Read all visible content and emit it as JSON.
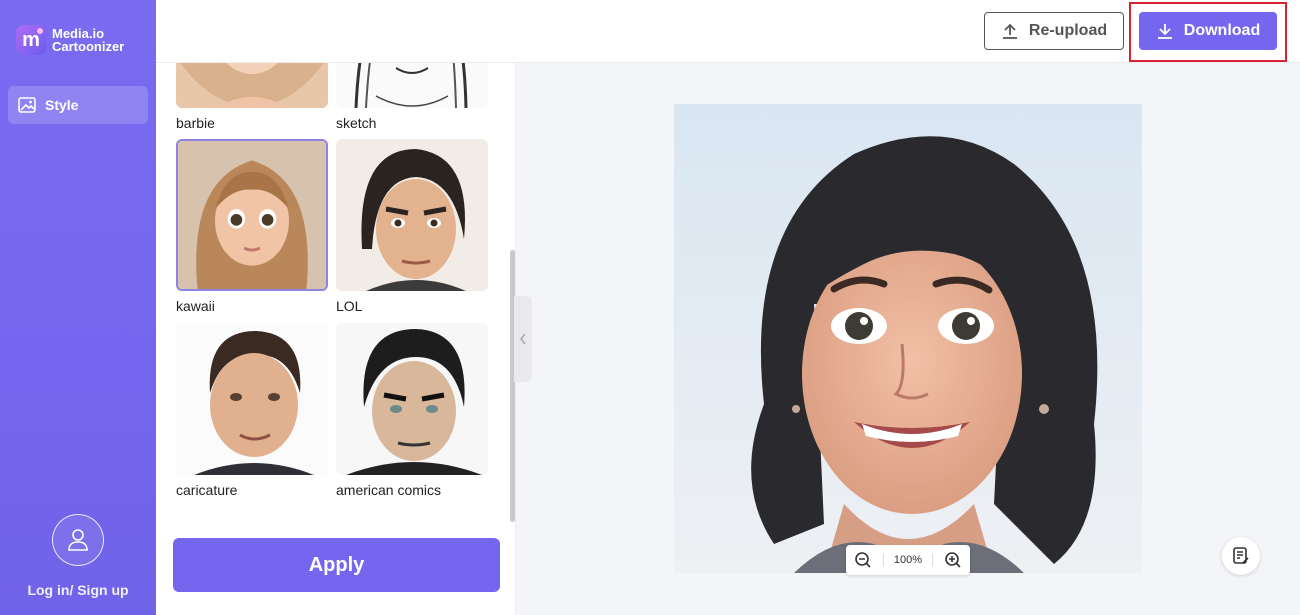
{
  "app": {
    "name_line1": "Media.io",
    "name_line2": "Cartoonizer"
  },
  "sidebar": {
    "nav_style_label": "Style",
    "login_label": "Log in/ Sign up"
  },
  "styles": {
    "items": [
      {
        "label": "barbie"
      },
      {
        "label": "sketch"
      },
      {
        "label": "kawaii",
        "selected": true
      },
      {
        "label": "LOL"
      },
      {
        "label": "caricature"
      },
      {
        "label": "american comics"
      }
    ],
    "apply_label": "Apply"
  },
  "toolbar": {
    "reupload_label": "Re-upload",
    "download_label": "Download"
  },
  "preview": {
    "zoom": "100%"
  },
  "colors": {
    "accent": "#7466ee",
    "highlight": "#d6232d"
  }
}
